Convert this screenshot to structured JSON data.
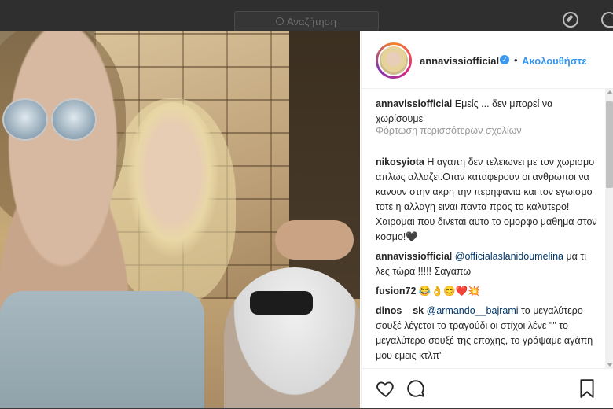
{
  "nav": {
    "search_placeholder": "Αναζήτηση",
    "icons": [
      "search-icon",
      "explore-icon",
      "activity-heart-icon"
    ]
  },
  "post": {
    "username": "annavissiofficial",
    "verified": true,
    "follow_label": "Ακολουθήστε",
    "separator": "•",
    "load_more": "Φόρτωση περισσότερων σχολίων",
    "comments": [
      {
        "user": "annavissiofficial",
        "text": "Εμείς ... δεν μπορεί να χωρίσουμε"
      },
      {
        "user": "nikosyiota",
        "text": "Η αγαπη δεν τελειωνει με τον χωρισμο απλως αλλαζει.Οταν καταφερουν οι ανθρωποι να κανουν στην ακρη την περηφανια και τον εγωισμο τοτε η αλλαγη ειναι παντα προς το καλυτερο! Χαιρομαι που δινεται αυτο το ομορφο μαθημα στον κοσμο!🖤"
      },
      {
        "user": "annavissiofficial",
        "mention": "@officialaslanidoumelina",
        "text": "μα τι λες τώρα !!!!! Σαγαπω"
      },
      {
        "user": "fusion72",
        "text": "😂👌😊❤️💥"
      },
      {
        "user": "dinos__sk",
        "mention": "@armando__bajrami",
        "text": "το μεγαλύτερο σουξέ λέγεται το τραγούδι οι στίχοι λένε \"\" το μεγαλύτερο σουξέ της εποχης, το γράψαμε αγάπη μου εμεις κτλπ\""
      }
    ],
    "actions": [
      "like-heart-icon",
      "comment-bubble-icon",
      "save-bookmark-icon"
    ]
  }
}
